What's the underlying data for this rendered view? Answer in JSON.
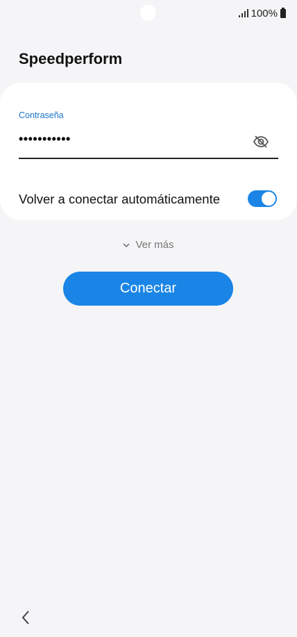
{
  "status_bar": {
    "battery_text": "100%",
    "icons": [
      "signal-icon",
      "battery-icon"
    ]
  },
  "header": {
    "title": "Speedperform"
  },
  "form": {
    "password_label": "Contraseña",
    "password_value": "•••••••••••",
    "visibility_icon": "eye-off-icon",
    "auto_reconnect_label": "Volver a conectar automáticamente",
    "auto_reconnect_enabled": true
  },
  "actions": {
    "see_more_label": "Ver más",
    "connect_label": "Conectar"
  },
  "nav": {
    "back_icon": "back-chevron-icon"
  },
  "colors": {
    "accent": "#1a85e6",
    "label_blue": "#1a73c8",
    "background": "#f5f5f7",
    "card": "#ffffff"
  }
}
